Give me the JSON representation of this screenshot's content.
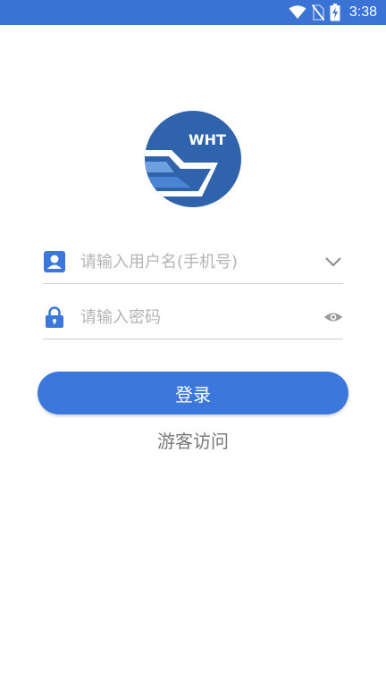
{
  "status_bar": {
    "time": "3:38",
    "icons": [
      "wifi-icon",
      "no-sim-icon",
      "battery-charging-icon"
    ],
    "background": "#3b73d4"
  },
  "logo": {
    "text": "WHT",
    "color": "#2f64ad"
  },
  "login_form": {
    "username": {
      "placeholder": "请输入用户名(手机号)",
      "value": "",
      "left_icon": "contact-card-icon",
      "right_icon": "chevron-down-icon"
    },
    "password": {
      "placeholder": "请输入密码",
      "value": "",
      "left_icon": "lock-icon",
      "right_icon": "eye-icon"
    },
    "login_button_label": "登录",
    "guest_link_label": "游客访问"
  },
  "colors": {
    "accent": "#3c78dc",
    "placeholder": "#b4b4b4",
    "secondary_text": "#7a7a7a",
    "divider": "#cfcfcf"
  }
}
